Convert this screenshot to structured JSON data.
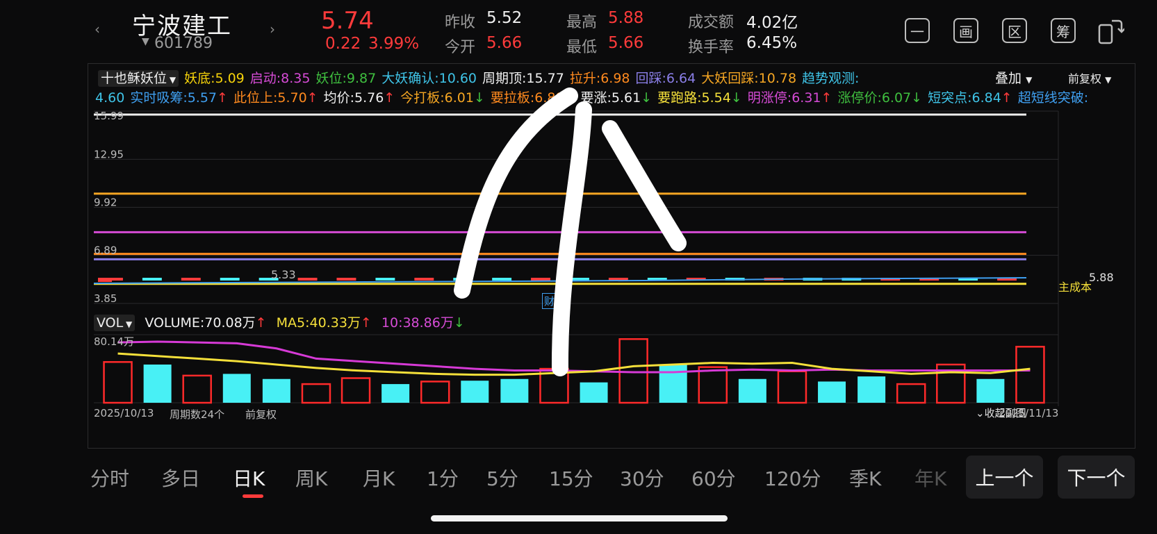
{
  "header": {
    "stock_name": "宁波建工",
    "stock_code": "601789",
    "price": "5.74",
    "change_amount": "0.22",
    "change_percent": "3.99%",
    "prev_close_label": "昨收",
    "prev_close": "5.52",
    "open_label": "今开",
    "open": "5.66",
    "high_label": "最高",
    "high": "5.88",
    "low_label": "最低",
    "low": "5.66",
    "amount_label": "成交额",
    "amount": "4.02亿",
    "turnover_label": "换手率",
    "turnover": "6.45%"
  },
  "toolbar": {
    "icons": [
      "一",
      "画",
      "区",
      "筹"
    ]
  },
  "indicator": {
    "selector": "十也稣妖位",
    "row1": [
      {
        "label": "妖底",
        "value": "5.09",
        "color": "#f5d20a",
        "arrow": ""
      },
      {
        "label": "启动",
        "value": "8.35",
        "color": "#d64bd6",
        "arrow": ""
      },
      {
        "label": "妖位",
        "value": "9.87",
        "color": "#3fbf3f",
        "arrow": ""
      },
      {
        "label": "大妖确认",
        "value": "10.60",
        "color": "#3fc4e8",
        "arrow": ""
      },
      {
        "label": "周期顶",
        "value": "15.77",
        "color": "#f0f0f0",
        "arrow": ""
      },
      {
        "label": "拉升",
        "value": "6.98",
        "color": "#ff8a1e",
        "arrow": ""
      },
      {
        "label": "回踩",
        "value": "6.64",
        "color": "#8b7fe8",
        "arrow": ""
      },
      {
        "label": "大妖回踩",
        "value": "10.78",
        "color": "#f5a623",
        "arrow": ""
      },
      {
        "label": "趋势观测",
        "value": "",
        "color": "#3fc4e8",
        "arrow": ""
      }
    ],
    "row2_lead": "4.60",
    "row2": [
      {
        "label": "实时吸筹",
        "value": "5.57",
        "color": "#3f9ff0",
        "arrow": "↑"
      },
      {
        "label": "此位上",
        "value": "5.70",
        "color": "#ff8a1e",
        "arrow": "↑"
      },
      {
        "label": "均价",
        "value": "5.76",
        "color": "#f0f0f0",
        "arrow": "↑"
      },
      {
        "label": "今打板",
        "value": "6.01",
        "color": "#f5a623",
        "arrow": "↓"
      },
      {
        "label": "要拉板",
        "value": "6.88",
        "color": "#ff8a1e",
        "arrow": "↓"
      },
      {
        "label": "要涨",
        "value": "5.61",
        "color": "#f0f0f0",
        "arrow": "↓"
      },
      {
        "label": "要跑路",
        "value": "5.54",
        "color": "#f5e03a",
        "arrow": "↓"
      },
      {
        "label": "明涨停",
        "value": "6.31",
        "color": "#d64bd6",
        "arrow": "↑"
      },
      {
        "label": "涨停价",
        "value": "6.07",
        "color": "#3fbf3f",
        "arrow": "↓"
      },
      {
        "label": "短突点",
        "value": "6.84",
        "color": "#3fc4e8",
        "arrow": "↑"
      },
      {
        "label": "超短线突破",
        "value": "",
        "color": "#3f9ff0",
        "arrow": ""
      }
    ],
    "overlay_label": "叠加",
    "adjust_label": "前复权"
  },
  "price_chart": {
    "y_ticks": [
      "15.99",
      "12.95",
      "9.92",
      "6.89",
      "3.85"
    ],
    "y_range": [
      3.85,
      15.99
    ],
    "lines": [
      {
        "value": 15.77,
        "color": "#f0f0f0"
      },
      {
        "value": 10.78,
        "color": "#f5a623"
      },
      {
        "value": 8.35,
        "color": "#d64bd6"
      },
      {
        "value": 6.98,
        "color": "#ff8a1e"
      },
      {
        "value": 6.64,
        "color": "#8b7fe8"
      },
      {
        "value": 5.09,
        "color": "#f5e03a"
      }
    ],
    "low_label": "5.33",
    "high_label": "5.88",
    "cost_label": "主成本",
    "event_badge": "财"
  },
  "volume": {
    "selector": "VOL",
    "volume_label": "VOLUME:70.08万",
    "ma5_label": "MA5:40.33万",
    "ma10_label": "10:38.86万",
    "max_tick": "80.14万",
    "max": 80.14,
    "bars": [
      {
        "v": 48,
        "up": true
      },
      {
        "v": 45,
        "up": false
      },
      {
        "v": 32,
        "up": true
      },
      {
        "v": 34,
        "up": false
      },
      {
        "v": 28,
        "up": false
      },
      {
        "v": 22,
        "up": true
      },
      {
        "v": 29,
        "up": true
      },
      {
        "v": 22,
        "up": false
      },
      {
        "v": 25,
        "up": true
      },
      {
        "v": 26,
        "up": false
      },
      {
        "v": 28,
        "up": false
      },
      {
        "v": 40,
        "up": true
      },
      {
        "v": 24,
        "up": false
      },
      {
        "v": 75,
        "up": true
      },
      {
        "v": 45,
        "up": false
      },
      {
        "v": 42,
        "up": true
      },
      {
        "v": 28,
        "up": false
      },
      {
        "v": 37,
        "up": true
      },
      {
        "v": 25,
        "up": false
      },
      {
        "v": 31,
        "up": false
      },
      {
        "v": 22,
        "up": true
      },
      {
        "v": 45,
        "up": true
      },
      {
        "v": 28,
        "up": false
      },
      {
        "v": 66,
        "up": true
      }
    ],
    "ma5": [
      58,
      55,
      52,
      49,
      45,
      41,
      38,
      36,
      34,
      33,
      33,
      35,
      37,
      43,
      45,
      47,
      46,
      47,
      40,
      37,
      34,
      36,
      35,
      40
    ],
    "ma10": [
      71,
      72,
      71,
      70,
      64,
      52,
      49,
      46,
      43,
      40,
      38,
      38,
      37,
      36,
      36,
      38,
      39,
      38,
      39,
      38,
      38,
      38,
      38,
      38
    ]
  },
  "footer": {
    "start_date": "2025/10/13",
    "period_count": "周期数24个",
    "adjust": "前复权",
    "collapse": "收起副图",
    "end_date": "2025/11/13"
  },
  "timeframes": [
    "分时",
    "多日",
    "日K",
    "周K",
    "月K",
    "1分",
    "5分",
    "15分",
    "30分",
    "60分",
    "120分",
    "季K",
    "年K"
  ],
  "active_timeframe": "日K",
  "nav": {
    "prev": "上一个",
    "next": "下一个"
  }
}
